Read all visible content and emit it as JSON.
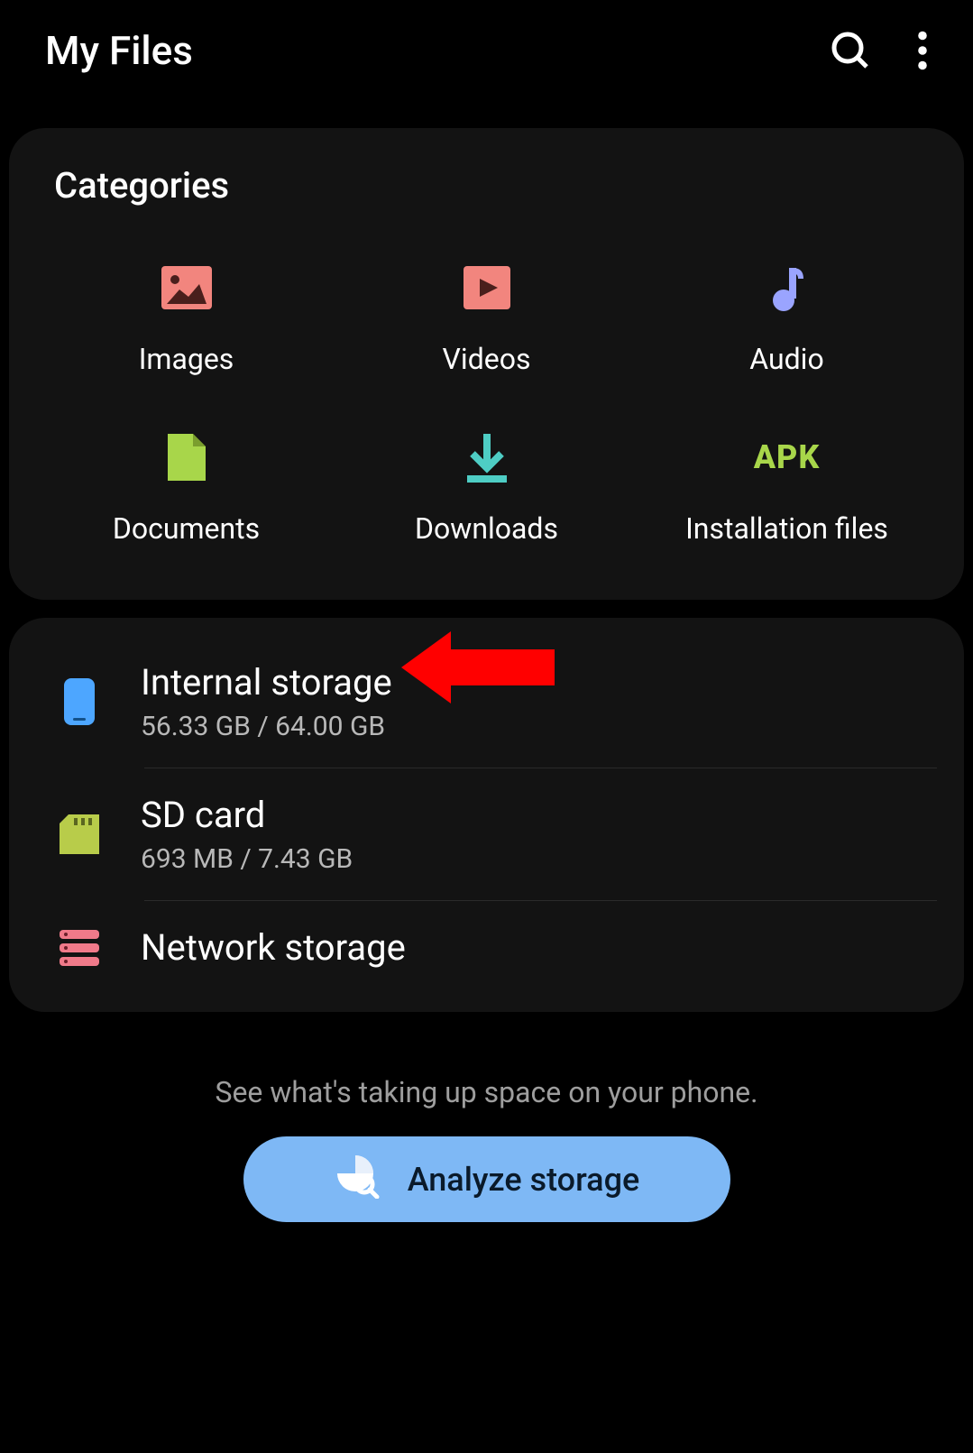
{
  "header": {
    "title": "My Files"
  },
  "categories": {
    "section_title": "Categories",
    "items": [
      {
        "label": "Images",
        "icon": "images-icon"
      },
      {
        "label": "Videos",
        "icon": "videos-icon"
      },
      {
        "label": "Audio",
        "icon": "audio-icon"
      },
      {
        "label": "Documents",
        "icon": "documents-icon"
      },
      {
        "label": "Downloads",
        "icon": "downloads-icon"
      },
      {
        "label": "Installation files",
        "icon": "apk-icon"
      }
    ]
  },
  "storage": {
    "items": [
      {
        "title": "Internal storage",
        "subtitle": "56.33 GB / 64.00 GB",
        "icon": "phone-icon"
      },
      {
        "title": "SD card",
        "subtitle": "693 MB / 7.43 GB",
        "icon": "sd-icon"
      },
      {
        "title": "Network storage",
        "icon": "network-icon"
      }
    ]
  },
  "hint": "See what's taking up space on your phone.",
  "analyze_button": "Analyze storage",
  "icons": {
    "apk_text": "APK"
  },
  "colors": {
    "images": "#f2857e",
    "videos": "#f2857e",
    "audio": "#9aa4ff",
    "documents": "#a8d64a",
    "downloads": "#4ecdc4",
    "apk": "#a8d64a",
    "phone": "#4da6ff",
    "sd": "#b8cc4a",
    "network": "#f07a8a",
    "analyze_bg": "#7eb8f5",
    "arrow": "#ff0000"
  }
}
